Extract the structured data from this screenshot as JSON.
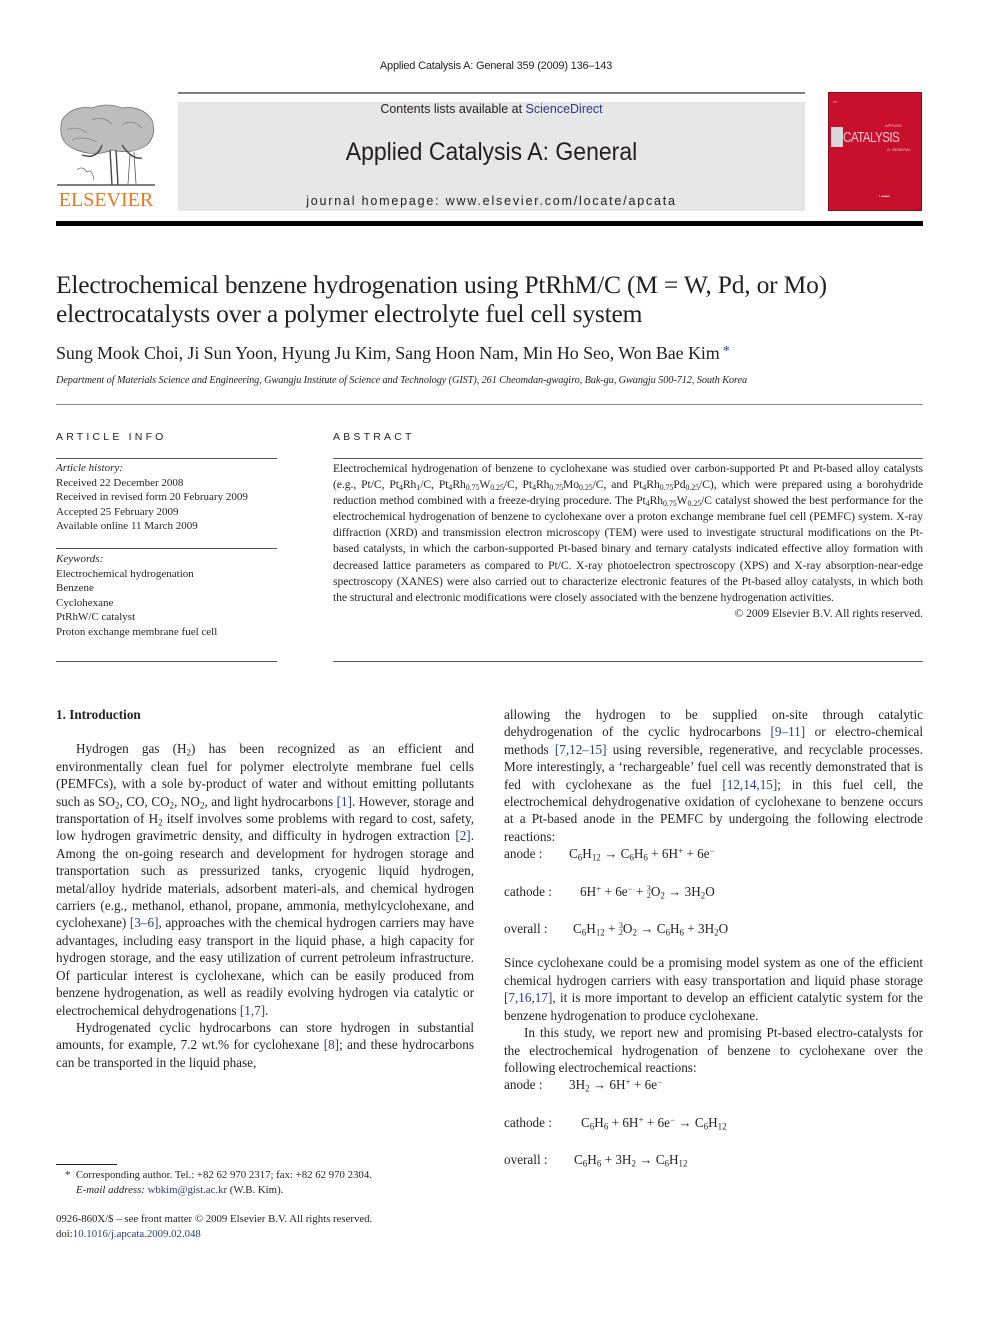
{
  "header": {
    "running_head": "Applied Catalysis A: General 359 (2009) 136–143",
    "contents_prefix": "Contents lists available at ",
    "contents_link": "ScienceDirect",
    "journal_name": "Applied Catalysis A: General",
    "homepage": "journal homepage: www.elsevier.com/locate/apcata",
    "publisher_logo_text": "ELSEVIER",
    "cover_title": "CATALYSIS",
    "cover_pre": "APPLIED",
    "cover_sub": "A: GENERAL",
    "colors": {
      "elsevier_orange": "#e87722",
      "cover_red": "#c8102e",
      "link_blue": "#2a3a8a",
      "banner_gray": "#e6e6e6"
    }
  },
  "article": {
    "title_line1": "Electrochemical benzene hydrogenation using PtRhM/C (M = W, Pd, or Mo)",
    "title_line2": "electrocatalysts over a polymer electrolyte fuel cell system",
    "authors": "Sung Mook Choi, Ji Sun Yoon, Hyung Ju Kim, Sang Hoon Nam, Min Ho Seo, Won Bae Kim",
    "corresponding_mark": "*",
    "affiliation": "Department of Materials Science and Engineering, Gwangju Institute of Science and Technology (GIST), 261 Cheomdan-gwagiro, Buk-gu, Gwangju 500-712, South Korea"
  },
  "article_info": {
    "heading": "ARTICLE INFO",
    "history_label": "Article history:",
    "history": [
      "Received 22 December 2008",
      "Received in revised form 20 February 2009",
      "Accepted 25 February 2009",
      "Available online 11 March 2009"
    ],
    "keywords_label": "Keywords:",
    "keywords": [
      "Electrochemical hydrogenation",
      "Benzene",
      "Cyclohexane",
      "PtRhW/C catalyst",
      "Proton exchange membrane fuel cell"
    ]
  },
  "abstract": {
    "heading": "ABSTRACT",
    "s1": "Electrochemical hydrogenation of benzene to cyclohexane was studied over carbon-supported Pt and Pt-based alloy catalysts (e.g., Pt/C, ",
    "s2": "which were prepared using a borohydride reduction method combined with a freeze-drying procedure. The ",
    "s3": " catalyst showed the best performance for the electrochemical hydrogenation of benzene to cyclohexane over a proton exchange membrane fuel cell (PEMFC) system. X-ray diffraction (XRD) and transmission electron microscopy (TEM) were used to investigate structural modifications on the Pt-based catalysts, in which the carbon-supported Pt-based binary and ternary catalysts indicated effective alloy formation with decreased lattice parameters as compared to Pt/C. X-ray photoelectron spectroscopy (XPS) and X-ray absorption-near-edge spectroscopy (XANES) were also carried out to characterize electronic features of the Pt-based alloy catalysts, in which both the structural and electronic modifications were closely associated with the benzene hydrogenation activities.",
    "copyright": "© 2009 Elsevier B.V. All rights reserved."
  },
  "intro": {
    "heading": "1.  Introduction",
    "refs": {
      "r1": "[1]",
      "r2": "[2]",
      "r3_6": "[3–6]",
      "r1_7": "[1,7]",
      "r8": "[8]",
      "r9_11": "[9–11]",
      "r7_12_15": "[7,12–15]",
      "r12_14_15": "[12,14,15]",
      "r7_16_17": "[7,16,17]"
    },
    "p1_a": "Hydrogen gas (H",
    "p1_b": ") has been recognized as an efficient and environmentally clean fuel for polymer electrolyte membrane fuel cells (PEMFCs), with a sole by-product of water and without emitting pollutants such as SO",
    "p1_c": ", CO, CO",
    "p1_d": ", NO",
    "p1_e": ", and light hydrocarbons ",
    "p1_f": ". However, storage and transportation of H",
    "p1_g": " itself involves some problems with regard to cost, safety, low hydrogen gravimetric density, and difficulty in hydrogen extraction ",
    "p1_h": ". Among the on-going research and development for hydrogen storage and transportation such as pressurized tanks, cryogenic liquid hydrogen, metal/alloy hydride materials, adsorbent materi-als, and chemical hydrogen carriers (e.g., methanol, ethanol, propane, ammonia, methylcyclohexane, and cyclohexane) ",
    "p1_i": ", approaches with the chemical hydrogen carriers may have advantages, including easy transport in the liquid phase, a high capacity for hydrogen storage, and the easy utilization of current petroleum infrastructure. Of particular interest is cyclohexane, which can be easily produced from benzene hydrogenation, as well as readily evolving hydrogen via catalytic or electrochemical dehydrogenations ",
    "p2_a": "Hydrogenated cyclic hydrocarbons can store hydrogen in substantial amounts, for example, 7.2 wt.% for cyclohexane ",
    "p2_b": "; and these hydrocarbons can be transported in the liquid phase, allowing the hydrogen to be supplied on-site through catalytic dehydrogenation of the cyclic hydrocarbons ",
    "p2_c": " or electro-chemical methods ",
    "p2_d": " using reversible, regenerative, and recyclable processes. More interestingly, a ‘rechargeable’ fuel cell was recently demonstrated that is fed with cyclohexane as the fuel ",
    "p2_e": "; in this fuel cell, the electrochemical dehydrogenative oxidation of cyclohexane to benzene occurs at a Pt-based anode in the PEMFC by undergoing the following electrode reactions:",
    "p3_a": "Since cyclohexane could be a promising model system as one of the efficient chemical hydrogen carriers with easy transportation and liquid phase storage ",
    "p3_b": ", it is more important to develop an efficient catalytic system for the benzene hydrogenation to produce cyclohexane.",
    "p4": "In this study, we report new and promising Pt-based electro-catalysts for the electrochemical hydrogenation of benzene to cyclohexane over the following electrochemical reactions:"
  },
  "equations": {
    "set1": {
      "anode_label": "anode :",
      "cathode_label": "cathode :",
      "overall_label": "overall :"
    },
    "set2": {
      "anode_label": "anode :",
      "cathode_label": "cathode :",
      "overall_label": "overall :"
    }
  },
  "footnotes": {
    "star": "*",
    "corresponding": "Corresponding author. Tel.: +82 62 970 2317; fax: +82 62 970 2304.",
    "email_label": "E-mail address:",
    "email": "wbkim@gist.ac.kr",
    "email_suffix": " (W.B. Kim).",
    "front_matter": "0926-860X/$ – see front matter © 2009 Elsevier B.V. All rights reserved.",
    "doi_label": "doi:",
    "doi": "10.1016/j.apcata.2009.02.048"
  }
}
